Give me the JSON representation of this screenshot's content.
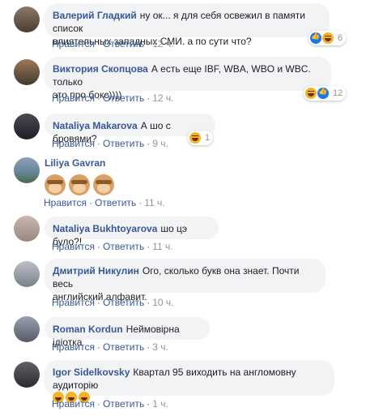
{
  "ui": {
    "like_label": "Нравится",
    "reply_label": "Ответить",
    "dot": "·"
  },
  "comments": [
    {
      "author": "Валерий Гладкий",
      "text_line1": "ну ок... я для себя освежил в памяти список",
      "text_line2": "влиятельных западных СМИ. а по сути что?",
      "time": "12 ч.",
      "reactions": [
        "like",
        "haha"
      ],
      "reaction_count": "6"
    },
    {
      "author": "Виктория Скопцова",
      "text_line1": "А есть еще IBF, WBA, WBO и WBC. только",
      "text_line2": "это про бокс))))",
      "time": "12 ч.",
      "reactions": [
        "haha",
        "like"
      ],
      "reaction_count": "12"
    },
    {
      "author": "Nataliya Makarova",
      "text_line1": "А шо с бровями?",
      "time": "9 ч.",
      "reactions": [
        "haha"
      ],
      "reaction_count": "1"
    },
    {
      "author": "Liliya Gavran",
      "emoji": [
        "monkey-face",
        "monkey-face",
        "monkey-face"
      ],
      "time": "11 ч."
    },
    {
      "author": "Nataliya Bukhtoyarova",
      "text_line1": "шо цэ було?!",
      "time": "11 ч."
    },
    {
      "author": "Дмитрий Никулин",
      "text_line1": "Ого, сколько букв она знает. Почти весь",
      "text_line2": "английский алфавит.",
      "time": "10 ч."
    },
    {
      "author": "Roman Kordun",
      "text_line1": "Неймовірна ідіотка",
      "time": "3 ч."
    },
    {
      "author": "Igor Sidelkovsky",
      "text_line1": "Квартал 95 виходить на англомовну аудиторію",
      "emoji": [
        "laughing-face",
        "laughing-face",
        "laughing-face"
      ],
      "time": "1 ч."
    }
  ],
  "colors": {
    "author": "#385898",
    "bubble": "#f2f3f5",
    "meta": "#90949c"
  }
}
